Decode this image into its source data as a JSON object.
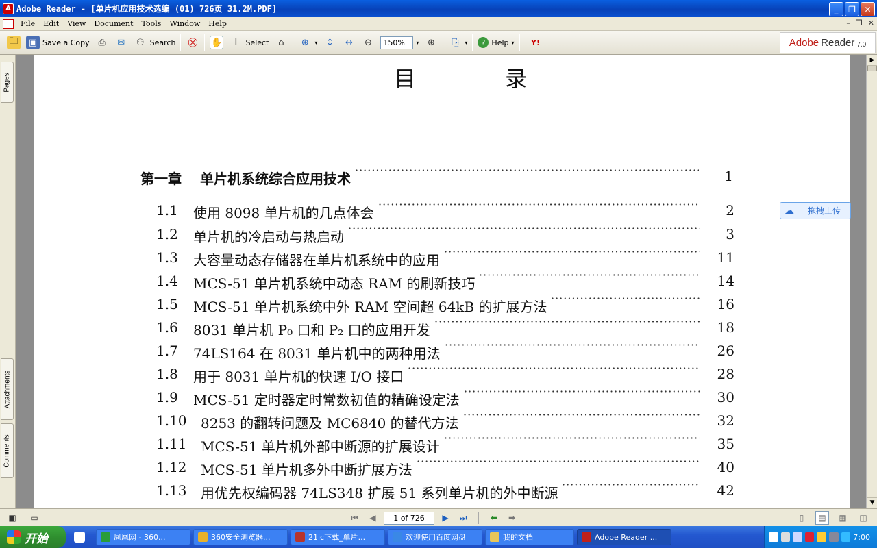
{
  "window": {
    "title": "Adobe Reader - [单片机应用技术选编 (01) 726页 31.2M.PDF]"
  },
  "menu": [
    "File",
    "Edit",
    "View",
    "Document",
    "Tools",
    "Window",
    "Help"
  ],
  "toolbar": {
    "save_copy": "Save a Copy",
    "search": "Search",
    "select": "Select",
    "zoom": "150%",
    "help": "Help",
    "logo": "Adobe",
    "logo2": "Reader",
    "logo_ver": "7.0"
  },
  "leftnav": {
    "pages": "Pages",
    "attachments": "Attachments",
    "comments": "Comments"
  },
  "document": {
    "title": "目 录",
    "toc": [
      {
        "num": "第一章",
        "text": "单片机系统综合应用技术",
        "page": "1",
        "chapter": true
      },
      {
        "num": "1.1",
        "text": "使用 8098 单片机的几点体会",
        "page": "2"
      },
      {
        "num": "1.2",
        "text": "单片机的冷启动与热启动",
        "page": "3"
      },
      {
        "num": "1.3",
        "text": "大容量动态存储器在单片机系统中的应用",
        "page": "11"
      },
      {
        "num": "1.4",
        "text": "MCS-51 单片机系统中动态 RAM 的刷新技巧",
        "page": "14"
      },
      {
        "num": "1.5",
        "text": "MCS-51 单片机系统中外 RAM 空间超 64kB 的扩展方法",
        "page": "16"
      },
      {
        "num": "1.6",
        "text": "8031 单片机 P₀ 口和 P₂ 口的应用开发",
        "page": "18"
      },
      {
        "num": "1.7",
        "text": "74LS164 在 8031 单片机中的两种用法",
        "page": "26"
      },
      {
        "num": "1.8",
        "text": "用于 8031 单片机的快速 I/O 接口",
        "page": "28"
      },
      {
        "num": "1.9",
        "text": "MCS-51 定时器定时常数初值的精确设定法",
        "page": "30"
      },
      {
        "num": "1.10",
        "text": "8253 的翻转问题及 MC6840 的替代方法",
        "page": "32"
      },
      {
        "num": "1.11",
        "text": "MCS-51 单片机外部中断源的扩展设计",
        "page": "35"
      },
      {
        "num": "1.12",
        "text": "MCS-51 单片机多外中断扩展方法",
        "page": "40"
      },
      {
        "num": "1.13",
        "text": "用优先权编码器 74LS348 扩展 51 系列单片机的外中断源",
        "page": "42"
      }
    ]
  },
  "upload": {
    "label": "拖拽上传"
  },
  "status": {
    "page": "1 of 726"
  },
  "taskbar": {
    "start": "开始",
    "tasks": [
      {
        "label": "凤凰网 - 360...",
        "color": "#2a9d3a"
      },
      {
        "label": "360安全浏览器...",
        "color": "#e8b12a"
      },
      {
        "label": "21ic下载_单片...",
        "color": "#b7342c"
      },
      {
        "label": "欢迎使用百度网盘",
        "color": "#3a88e6"
      },
      {
        "label": "我的文档",
        "color": "#e8c55a"
      },
      {
        "label": "Adobe Reader ...",
        "color": "#c0201a",
        "active": true
      }
    ],
    "clock": "7:00"
  }
}
